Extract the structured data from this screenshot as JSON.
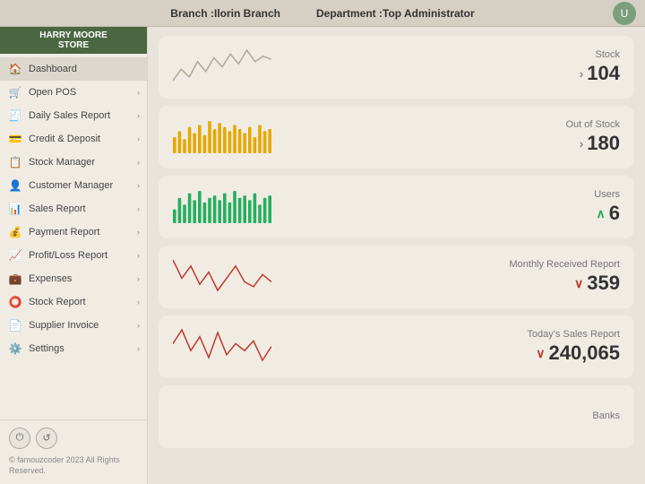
{
  "header": {
    "branch_label": "Branch :",
    "branch_value": "Ilorin Branch",
    "department_label": "Department :",
    "department_value": "Top Administrator"
  },
  "sidebar": {
    "logo_line1": "HARRY MOORE",
    "logo_line2": "STORE",
    "nav_items": [
      {
        "id": "dashboard",
        "label": "Dashboard",
        "icon": "home",
        "arrow": false
      },
      {
        "id": "open-pos",
        "label": "Open POS",
        "icon": "cart",
        "arrow": true
      },
      {
        "id": "daily-sales",
        "label": "Daily Sales Report",
        "icon": "receipt",
        "arrow": true
      },
      {
        "id": "credit-deposit",
        "label": "Credit & Deposit",
        "icon": "card",
        "arrow": true
      },
      {
        "id": "stock-manager",
        "label": "Stock Manager",
        "icon": "list",
        "arrow": true
      },
      {
        "id": "customer-manager",
        "label": "Customer Manager",
        "icon": "person",
        "arrow": true
      },
      {
        "id": "sales-report",
        "label": "Sales Report",
        "icon": "chart",
        "arrow": true
      },
      {
        "id": "payment-report",
        "label": "Payment Report",
        "icon": "payment",
        "arrow": true
      },
      {
        "id": "profit-loss",
        "label": "Profit/Loss Report",
        "icon": "profit",
        "arrow": true
      },
      {
        "id": "expenses",
        "label": "Expenses",
        "icon": "expense",
        "arrow": true
      },
      {
        "id": "stock-report",
        "label": "Stock Report",
        "icon": "circle",
        "arrow": true
      },
      {
        "id": "supplier-invoice",
        "label": "Supplier Invoice",
        "icon": "invoice",
        "arrow": true
      },
      {
        "id": "settings",
        "label": "Settings",
        "icon": "gear",
        "arrow": true
      }
    ],
    "footer_text": "© famouzcoder 2023 All Rights Reserved."
  },
  "cards": [
    {
      "id": "stock",
      "label": "Stock",
      "value": "104",
      "indicator": "right",
      "indicator_class": "up",
      "chart_type": "line",
      "chart_color": "#b0a898"
    },
    {
      "id": "out-of-stock",
      "label": "Out of Stock",
      "value": "180",
      "indicator": "right",
      "indicator_class": "up",
      "chart_type": "bar",
      "chart_color": "#e6a800"
    },
    {
      "id": "users",
      "label": "Users",
      "value": "6",
      "indicator": "up",
      "indicator_class": "up-green",
      "chart_type": "bar",
      "chart_color": "#27ae60"
    },
    {
      "id": "monthly-received",
      "label": "Monthly Received Report",
      "value": "359",
      "indicator": "down",
      "indicator_class": "down-red",
      "chart_type": "line",
      "chart_color": "#c0392b"
    },
    {
      "id": "todays-sales",
      "label": "Today's Sales Report",
      "value": "240,065",
      "indicator": "down",
      "indicator_class": "down-red",
      "chart_type": "line",
      "chart_color": "#c0392b"
    },
    {
      "id": "banks",
      "label": "Banks",
      "value": "",
      "indicator": "",
      "indicator_class": "",
      "chart_type": "none",
      "chart_color": ""
    }
  ]
}
